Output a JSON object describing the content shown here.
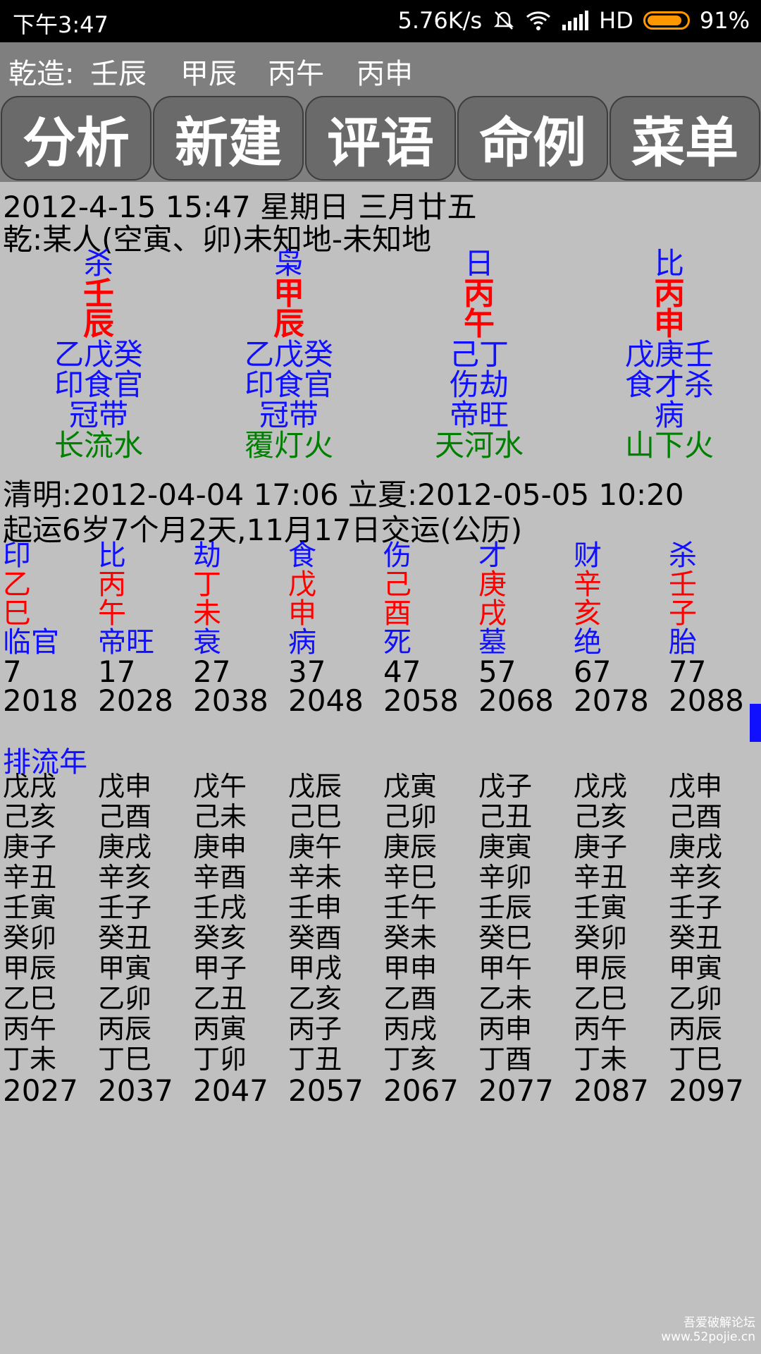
{
  "status": {
    "time": "下午3:47",
    "speed": "5.76K/s",
    "network": "HD",
    "battery": "91%"
  },
  "header": {
    "label": "乾造:",
    "pillars": [
      "壬辰",
      "甲辰",
      "丙午",
      "丙申"
    ]
  },
  "toolbar": {
    "buttons": [
      "分析",
      "新建",
      "评语",
      "命例",
      "菜单"
    ]
  },
  "info": {
    "date_line": "2012-4-15 15:47  星期日  三月廿五",
    "person_line": "乾:某人(空寅、卯)未知地-未知地"
  },
  "pillars": [
    {
      "god": "杀",
      "stem": "壬",
      "branch": "辰",
      "hidden": "乙戊癸",
      "hidden_gods": "印食官",
      "stage": "冠带",
      "nayin": "长流水"
    },
    {
      "god": "枭",
      "stem": "甲",
      "branch": "辰",
      "hidden": "乙戊癸",
      "hidden_gods": "印食官",
      "stage": "冠带",
      "nayin": "覆灯火"
    },
    {
      "god": "日",
      "stem": "丙",
      "branch": "午",
      "hidden": "己丁",
      "hidden_gods": "伤劫",
      "stage": "帝旺",
      "nayin": "天河水"
    },
    {
      "god": "比",
      "stem": "丙",
      "branch": "申",
      "hidden": "戊庚壬",
      "hidden_gods": "食才杀",
      "stage": "病",
      "nayin": "山下火"
    }
  ],
  "terms": {
    "line": "清明:2012-04-04 17:06  立夏:2012-05-05 10:20",
    "qiyun": "起运6岁7个月2天,11月17日交运(公历)"
  },
  "dayun": [
    {
      "god": "印",
      "stem": "乙",
      "branch": "巳",
      "stage": "临官",
      "age": "7",
      "year": "2018"
    },
    {
      "god": "比",
      "stem": "丙",
      "branch": "午",
      "stage": "帝旺",
      "age": "17",
      "year": "2028"
    },
    {
      "god": "劫",
      "stem": "丁",
      "branch": "未",
      "stage": "衰",
      "age": "27",
      "year": "2038"
    },
    {
      "god": "食",
      "stem": "戊",
      "branch": "申",
      "stage": "病",
      "age": "37",
      "year": "2048"
    },
    {
      "god": "伤",
      "stem": "己",
      "branch": "酉",
      "stage": "死",
      "age": "47",
      "year": "2058"
    },
    {
      "god": "才",
      "stem": "庚",
      "branch": "戌",
      "stage": "墓",
      "age": "57",
      "year": "2068"
    },
    {
      "god": "财",
      "stem": "辛",
      "branch": "亥",
      "stage": "绝",
      "age": "67",
      "year": "2078"
    },
    {
      "god": "杀",
      "stem": "壬",
      "branch": "子",
      "stage": "胎",
      "age": "77",
      "year": "2088"
    }
  ],
  "liunian_label": "排流年",
  "liunian": [
    {
      "years": [
        "戊戌",
        "己亥",
        "庚子",
        "辛丑",
        "壬寅",
        "癸卯",
        "甲辰",
        "乙巳",
        "丙午",
        "丁未"
      ],
      "end": "2027"
    },
    {
      "years": [
        "戊申",
        "己酉",
        "庚戌",
        "辛亥",
        "壬子",
        "癸丑",
        "甲寅",
        "乙卯",
        "丙辰",
        "丁巳"
      ],
      "end": "2037"
    },
    {
      "years": [
        "戊午",
        "己未",
        "庚申",
        "辛酉",
        "壬戌",
        "癸亥",
        "甲子",
        "乙丑",
        "丙寅",
        "丁卯"
      ],
      "end": "2047"
    },
    {
      "years": [
        "戊辰",
        "己巳",
        "庚午",
        "辛未",
        "壬申",
        "癸酉",
        "甲戌",
        "乙亥",
        "丙子",
        "丁丑"
      ],
      "end": "2057"
    },
    {
      "years": [
        "戊寅",
        "己卯",
        "庚辰",
        "辛巳",
        "壬午",
        "癸未",
        "甲申",
        "乙酉",
        "丙戌",
        "丁亥"
      ],
      "end": "2067"
    },
    {
      "years": [
        "戊子",
        "己丑",
        "庚寅",
        "辛卯",
        "壬辰",
        "癸巳",
        "甲午",
        "乙未",
        "丙申",
        "丁酉"
      ],
      "end": "2077"
    },
    {
      "years": [
        "戊戌",
        "己亥",
        "庚子",
        "辛丑",
        "壬寅",
        "癸卯",
        "甲辰",
        "乙巳",
        "丙午",
        "丁未"
      ],
      "end": "2087"
    },
    {
      "years": [
        "戊申",
        "己酉",
        "庚戌",
        "辛亥",
        "壬子",
        "癸丑",
        "甲寅",
        "乙卯",
        "丙辰",
        "丁巳"
      ],
      "end": "2097"
    }
  ],
  "watermark": {
    "line1": "吾爱破解论坛",
    "line2": "www.52pojie.cn"
  },
  "colors": {
    "god": "#1010ff",
    "stem_branch": "#ff0000",
    "nayin": "#008000",
    "toolbar": "#7f7f7f",
    "background": "#c0c0c0"
  }
}
